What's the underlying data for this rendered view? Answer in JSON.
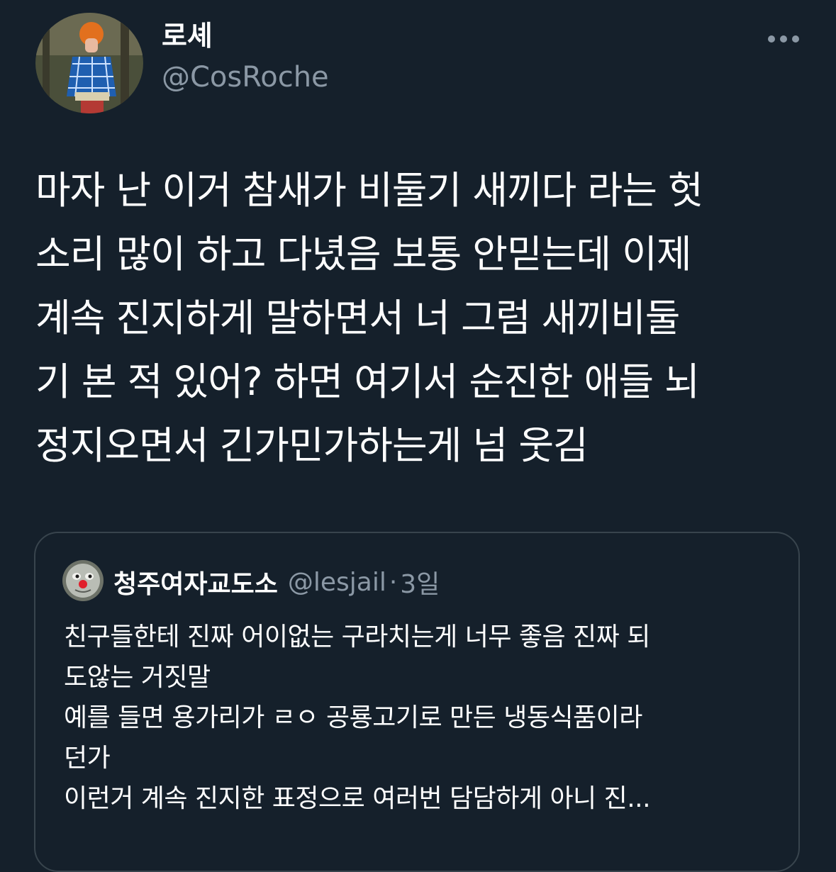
{
  "colors": {
    "background": "#15202b",
    "text_primary": "#ffffff",
    "text_secondary": "#8b98a5",
    "card_border": "#38444d",
    "avatar_bg": "#3c4a3a",
    "accent_blue": "#1d9bf0"
  },
  "author": {
    "display_name": "로셰",
    "handle": "@CosRoche",
    "avatar_icon": "profile-photo-icon"
  },
  "more_icon": "more-horizontal-icon",
  "tweet": {
    "lines": [
      "마자 난 이거 참새가 비둘기 새끼다 라는 헛",
      "소리 많이 하고 다녔음 보통 안믿는데 이제",
      "계속 진지하게 말하면서 너 그럼 새끼비둘",
      "기 본 적 있어? 하면 여기서 순진한 애들 뇌",
      "정지오면서 긴가민가하는게 넘 웃김"
    ]
  },
  "quoted_tweet": {
    "display_name": "청주여자교도소",
    "handle": "@lesjail",
    "separator": "·",
    "time": "3일",
    "avatar_icon": "thomas-tank-face-icon",
    "lines": [
      "친구들한테 진짜 어이없는 구라치는게 너무 좋음 진짜 되",
      "도않는 거짓말",
      "예를 들면 용가리가 ㄹㅇ 공룡고기로 만든 냉동식품이라",
      "던가",
      "이런거 계속 진지한 표정으로 여러번 담담하게 아니 진..."
    ]
  }
}
